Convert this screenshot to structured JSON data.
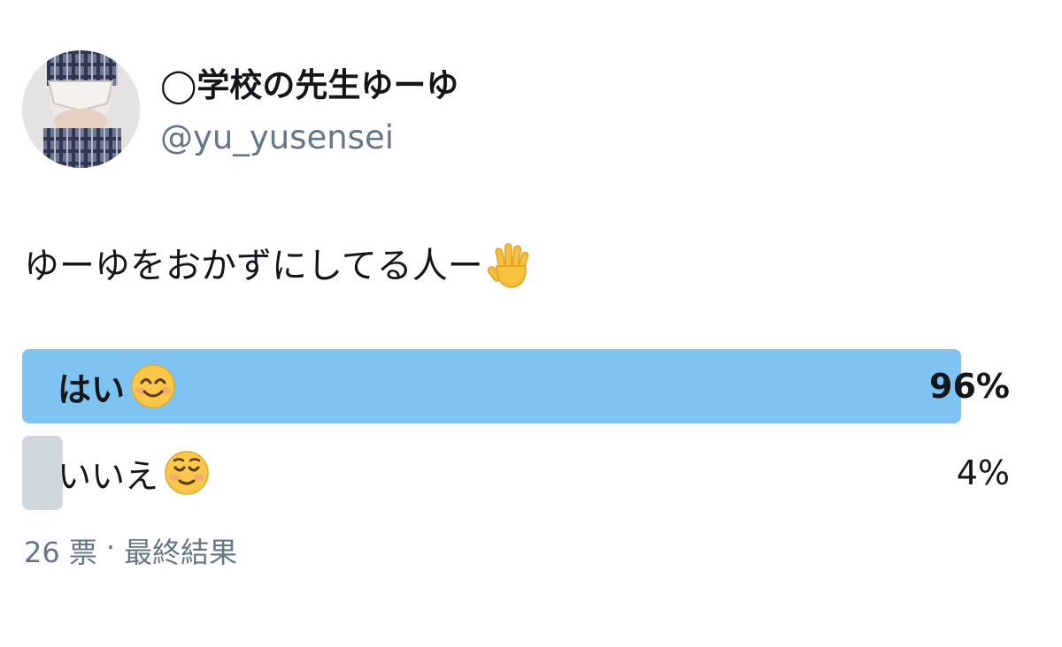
{
  "user": {
    "display_name": "◯学校の先生ゆーゆ",
    "handle": "@yu_yusensei"
  },
  "tweet": {
    "text": "ゆーゆをおかずにしてる人ー",
    "text_emoji_icon": "raised-hand-icon"
  },
  "poll": {
    "options": [
      {
        "label": "はい",
        "emoji_icon": "smiling-face-icon",
        "percent_text": "96%",
        "percent": 96,
        "winner": true,
        "bar_color": "#7fc3f3"
      },
      {
        "label": "いいえ",
        "emoji_icon": "relieved-face-icon",
        "percent_text": "4%",
        "percent": 4,
        "winner": false,
        "bar_color": "#d0d7dd"
      }
    ],
    "votes": "26 票",
    "separator": "·",
    "status": "最終結果"
  }
}
